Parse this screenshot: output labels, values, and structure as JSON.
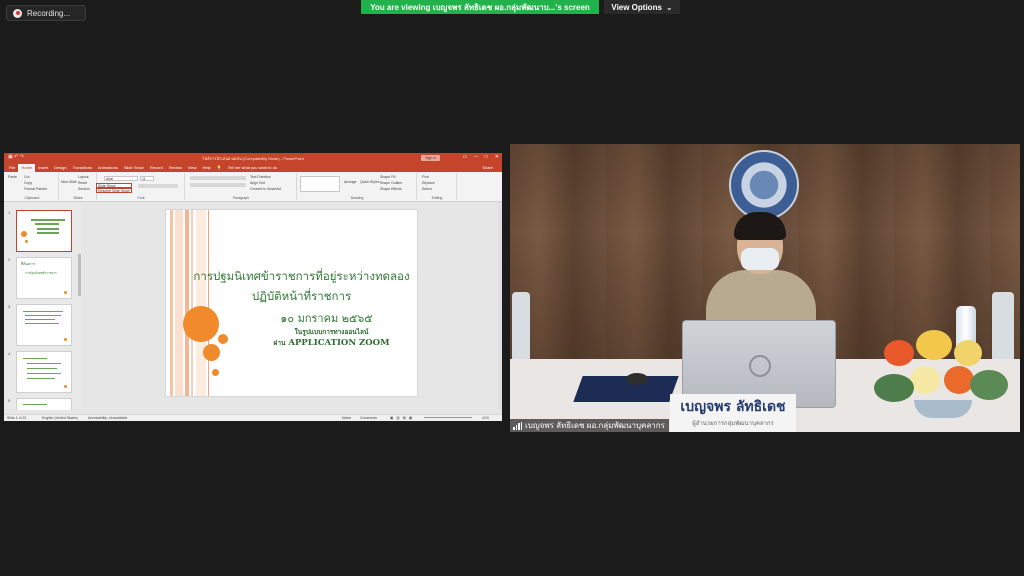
{
  "top_bar": {
    "recording_label": "Recording...",
    "banner_text": "You are viewing เบญจพร ลัทธิเดช ผอ.กลุ่มพัฒนาบ...'s screen",
    "view_options_label": "View Options",
    "banner_color": "#22b24c"
  },
  "ppt": {
    "window_title": "ไฟล์การนำเสนอ ผมชน (Compatibility Mode) - PowerPoint",
    "sign_in": "Sign in",
    "accent_color": "#c4452b",
    "tabs": [
      "File",
      "Home",
      "Insert",
      "Design",
      "Transitions",
      "Animations",
      "Slide Show",
      "Record",
      "Review",
      "View",
      "Help"
    ],
    "active_tab": "Home",
    "tell_me": "Tell me what you want to do",
    "share": "Share",
    "ribbon": {
      "paste": "Paste",
      "cut": "Cut",
      "copy": "Copy",
      "format_painter": "Format Painter",
      "clipboard": "Clipboard",
      "new_slide": "New Slide",
      "layout": "Layout",
      "reset": "Reset",
      "section": "Section",
      "slides": "Slides",
      "font_name": "Arial",
      "font_size": "11",
      "slide_show_box1": "Slide Show",
      "slide_show_box2": "Resume Slide Show",
      "font": "Font",
      "text_direction": "Text Direction",
      "align_text": "Align Text",
      "convert_smartart": "Convert to SmartArt",
      "paragraph": "Paragraph",
      "arrange": "Arrange",
      "quick_styles": "Quick Styles",
      "shape_fill": "Shape Fill",
      "shape_outline": "Shape Outline",
      "shape_effects": "Shape Effects",
      "drawing": "Drawing",
      "find": "Find",
      "replace": "Replace",
      "select": "Select",
      "editing": "Editing"
    },
    "slide_numbers": [
      "1",
      "2",
      "3",
      "4",
      "5"
    ],
    "slide2_title": "ที่ต้องการ",
    "slide2_sub": "การปฐมนิเทศข้าราชการ",
    "slide": {
      "title_line1": "การปฐมนิเทศข้าราชการที่อยู่ระหว่างทดลอง",
      "title_line2": "ปฏิบัติหน้าที่ราชการ",
      "date": "๑๐ มกราคม ๒๕๖๕",
      "subtitle": "ในรูปแบบการทางออนไลน์",
      "app_prefix": "ผ่าน",
      "app_name": "APPLICATION ZOOM"
    },
    "status": {
      "slide_count": "Slide 1 of 21",
      "language": "English (United States)",
      "accessibility": "Accessibility: Unavailable",
      "notes": "Notes",
      "comments": "Comments",
      "zoom": "41%"
    }
  },
  "video": {
    "name_card": "เบญจพร ลัทธิเดช",
    "name_card_sub": "ผู้อำนวยการกลุ่มพัฒนาบุคลากร",
    "participant_name": "เบญจพร ลัทธิเดช ผอ.กลุ่มพัฒนาบุคลากร"
  }
}
